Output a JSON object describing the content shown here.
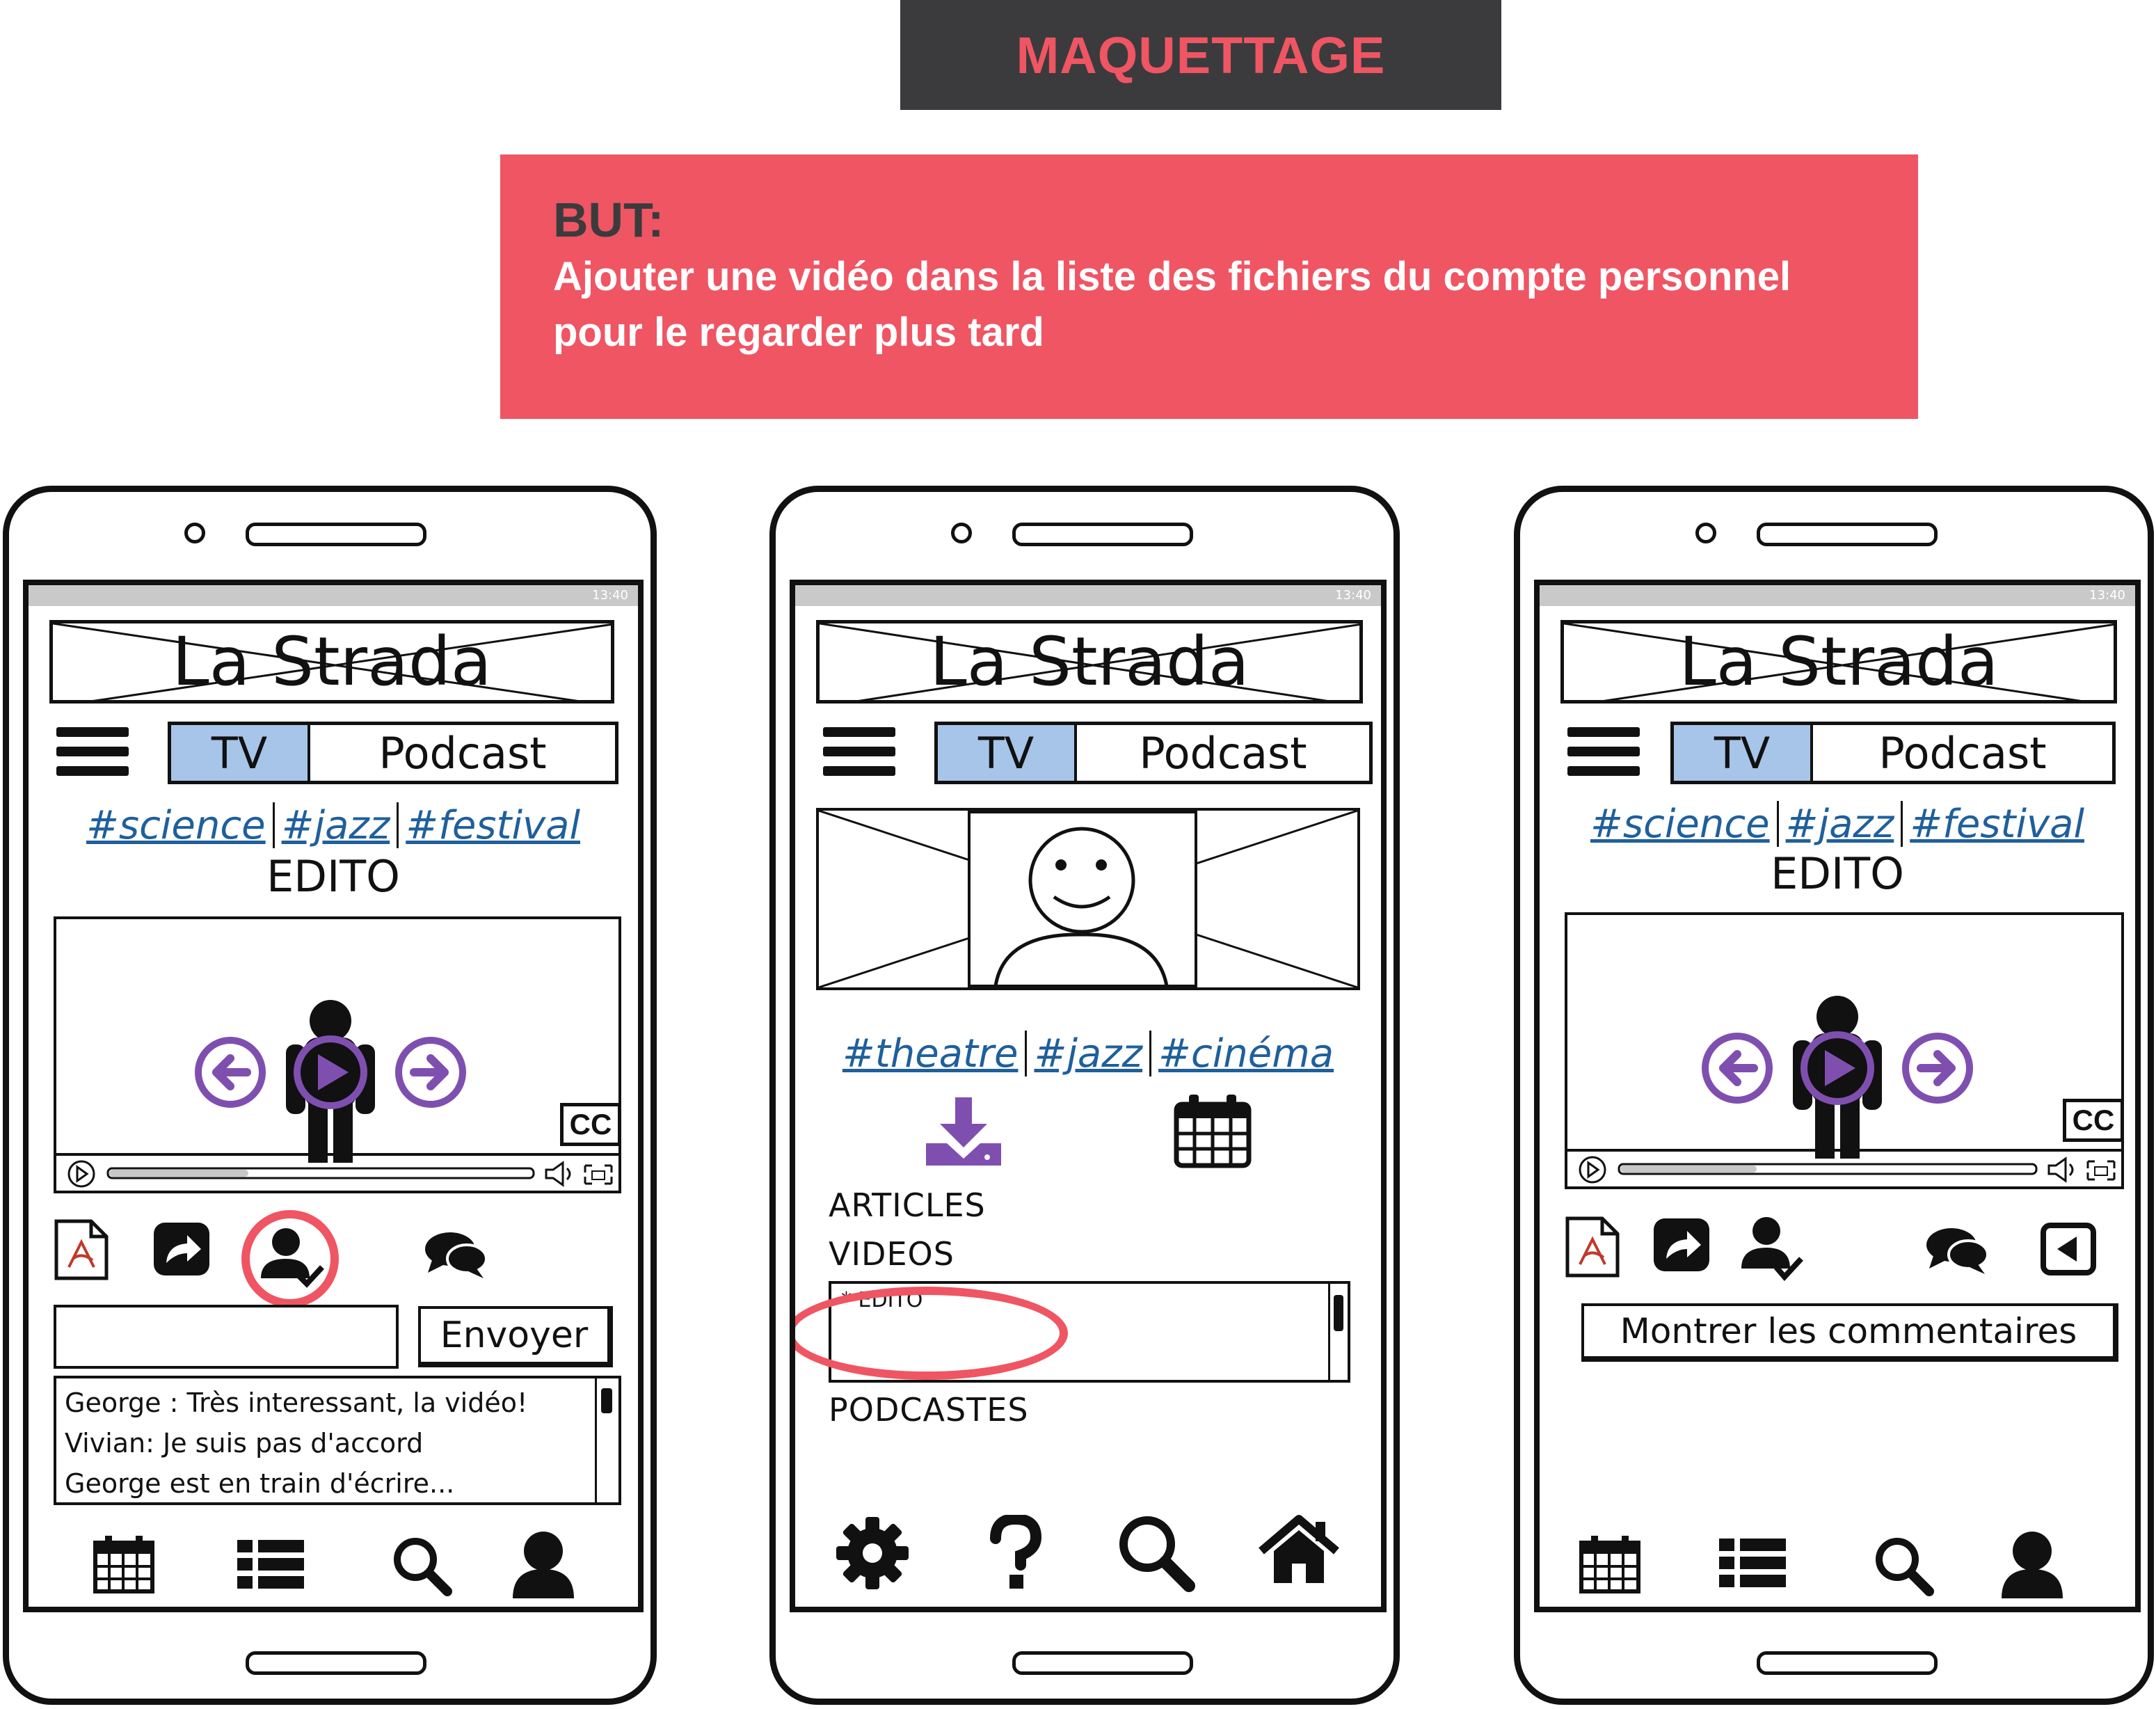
{
  "header": {
    "title": "MAQUETTAGE",
    "goal_label": "BUT:",
    "goal_text": "Ajouter une vidéo dans la liste des fichiers du compte personnel pour le regarder plus tard"
  },
  "colors": {
    "banner_dark": "#3b3b3d",
    "accent_red": "#ef5563",
    "tab_selected": "#a7c5e8",
    "tag_blue": "#1f5f9c",
    "icon_purple": "#7f4fb0"
  },
  "phones": [
    {
      "status": "13:40",
      "logo": "La Strada",
      "tabs": [
        "TV",
        "Podcast"
      ],
      "tags": [
        "#science",
        "#jazz",
        "#festival"
      ],
      "section_title": "EDITO",
      "cc_label": "CC",
      "send_button": "Envoyer",
      "comment_input_value": "",
      "comments": [
        "George : Très interessant, la vidéo!",
        "Vivian: Je suis pas d'accord",
        "George est en train d'écrire..."
      ],
      "action_icons": [
        "pdf-icon",
        "share-icon",
        "add-user-icon",
        "chat-icon"
      ],
      "bottom_nav": [
        "calendar-icon",
        "list-icon",
        "search-icon",
        "user-icon"
      ]
    },
    {
      "status": "13:40",
      "logo": "La Strada",
      "tabs": [
        "TV",
        "Podcast"
      ],
      "tags": [
        "#theatre",
        "#jazz",
        "#cinéma"
      ],
      "sections": {
        "articles": "ARTICLES",
        "videos": "VIDEOS",
        "video_item": "* EDITO",
        "podcasts": "PODCASTES"
      },
      "profile_icons": [
        "download-icon",
        "calendar-icon"
      ],
      "bottom_nav": [
        "gear-icon",
        "help-icon",
        "search-icon",
        "home-icon"
      ]
    },
    {
      "status": "13:40",
      "logo": "La Strada",
      "tabs": [
        "TV",
        "Podcast"
      ],
      "tags": [
        "#science",
        "#jazz",
        "#festival"
      ],
      "section_title": "EDITO",
      "cc_label": "CC",
      "show_comments_button": "Montrer les commentaires",
      "action_icons": [
        "pdf-icon",
        "share-icon",
        "user-check-icon",
        "chat-icon",
        "back-icon"
      ],
      "bottom_nav": [
        "calendar-icon",
        "list-icon",
        "search-icon",
        "user-icon"
      ]
    }
  ]
}
